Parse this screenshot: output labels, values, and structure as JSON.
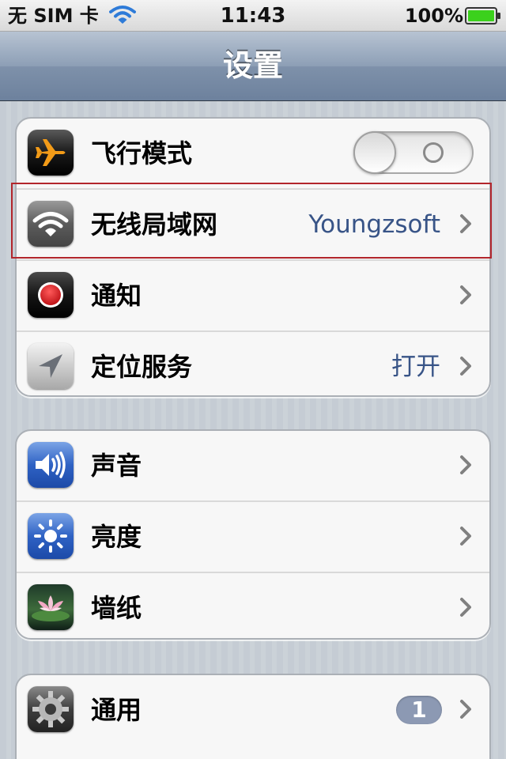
{
  "status_bar": {
    "carrier": "无 SIM 卡",
    "time": "11:43",
    "battery_text": "100%",
    "battery_level": 1.0,
    "wifi_icon": "wifi-icon",
    "battery_icon": "battery-icon"
  },
  "nav": {
    "title": "设置"
  },
  "groups": [
    {
      "cells": [
        {
          "label": "飞行模式",
          "icon": "airplane-icon",
          "control": "toggle",
          "toggle_on": false
        },
        {
          "label": "无线局域网",
          "icon": "wifi-settings-icon",
          "value": "Youngzsoft",
          "control": "chevron"
        },
        {
          "label": "通知",
          "icon": "notifications-icon",
          "control": "chevron"
        },
        {
          "label": "定位服务",
          "icon": "location-icon",
          "value": "打开",
          "control": "chevron"
        }
      ]
    },
    {
      "cells": [
        {
          "label": "声音",
          "icon": "sound-icon",
          "control": "chevron"
        },
        {
          "label": "亮度",
          "icon": "brightness-icon",
          "control": "chevron"
        },
        {
          "label": "墙纸",
          "icon": "wallpaper-icon",
          "control": "chevron"
        }
      ]
    },
    {
      "cells": [
        {
          "label": "通用",
          "icon": "general-gear-icon",
          "badge": "1",
          "control": "chevron"
        }
      ]
    }
  ],
  "colors": {
    "value_text": "#385487",
    "highlight_border": "#b2262c",
    "badge_bg": "#8c99b3",
    "battery_green": "#3bd11c"
  }
}
